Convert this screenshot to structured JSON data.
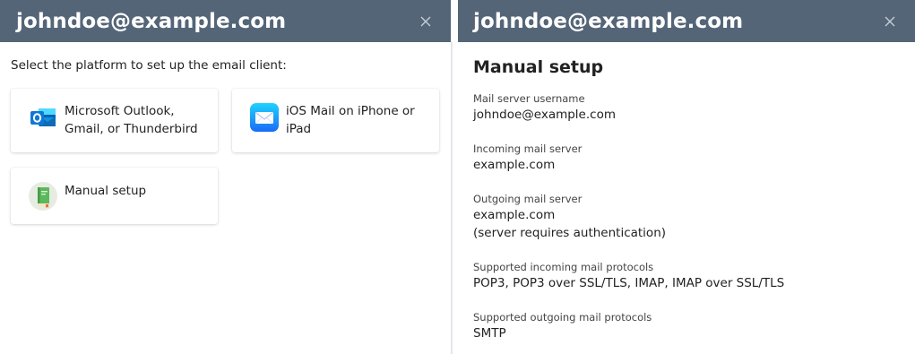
{
  "left_panel": {
    "title": "johndoe@example.com",
    "intro": "Select the platform to set up the email client:",
    "cards": {
      "outlook": {
        "label": "Microsoft Outlook, Gmail, or Thunderbird",
        "icon": "outlook-icon"
      },
      "ios": {
        "label": "iOS Mail on iPhone or iPad",
        "icon": "ios-mail-icon"
      },
      "manual": {
        "label": "Manual setup",
        "icon": "book-icon"
      }
    }
  },
  "right_panel": {
    "title": "johndoe@example.com",
    "heading": "Manual setup",
    "fields": {
      "username": {
        "label": "Mail server username",
        "value": "johndoe@example.com"
      },
      "incoming": {
        "label": "Incoming mail server",
        "value": "example.com"
      },
      "outgoing": {
        "label": "Outgoing mail server",
        "value": "example.com",
        "note": "(server requires authentication)"
      },
      "incoming_protocols": {
        "label": "Supported incoming mail protocols",
        "value": "POP3, POP3 over SSL/TLS, IMAP, IMAP over SSL/TLS"
      },
      "outgoing_protocols": {
        "label": "Supported outgoing mail protocols",
        "value": "SMTP"
      }
    }
  },
  "colors": {
    "header_bg": "#546578",
    "header_text": "#ffffff"
  }
}
